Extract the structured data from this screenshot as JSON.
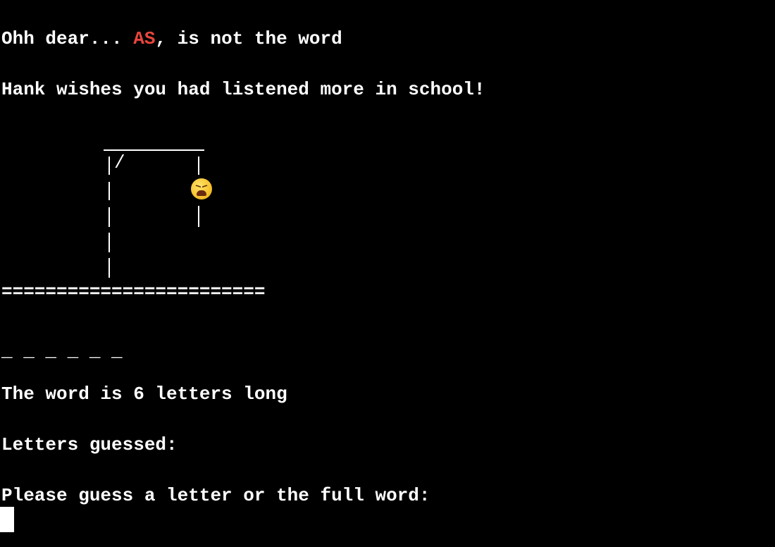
{
  "terminal": {
    "message_prefix": "Ohh dear... ",
    "guess_word": "AS",
    "message_suffix": ", is not the word",
    "hint_line": "Hank wishes you had listened more in school!",
    "gallows_slash": "/",
    "ground_line": "========================",
    "word_blanks": "_ _ _ _ _ _",
    "word_length_text": "The word is 6 letters long",
    "letters_guessed_label": "Letters guessed:",
    "prompt_text": "Please guess a letter or the full word:",
    "face_icon": "weary-face-emoji"
  },
  "colors": {
    "background": "#000000",
    "text": "#ffffff",
    "highlight": "#e8453c"
  }
}
